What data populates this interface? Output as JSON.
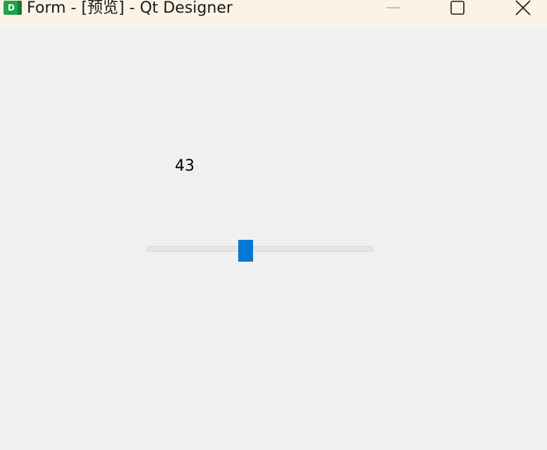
{
  "window": {
    "title": "Form - [预览] - Qt Designer",
    "app_icon_letter": "D",
    "icons": {
      "app": "qt-designer-icon",
      "minimize": "minimize-icon",
      "maximize": "maximize-icon",
      "close": "close-icon"
    }
  },
  "form": {
    "label_value": "43",
    "slider": {
      "value_fraction": 0.43,
      "handle_color": "#0078d4",
      "groove_color": "#e6e6e6"
    }
  }
}
